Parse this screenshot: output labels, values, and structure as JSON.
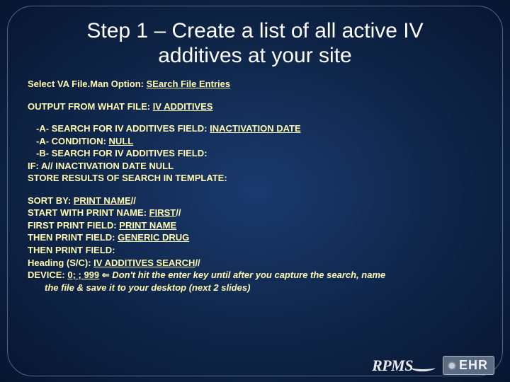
{
  "title_l1": "Step 1 – Create a list of all active IV",
  "title_l2": "additives at your site",
  "line_select_pre": "Select VA File.Man Option: ",
  "line_select_u": "SEarch File Entries",
  "line_output_pre": "OUTPUT FROM WHAT FILE: ",
  "line_output_u": "IV ADDITIVES",
  "line_a1_pre": "-A- SEARCH FOR IV ADDITIVES FIELD: ",
  "line_a1_u": "INACTIVATION DATE",
  "line_a2_pre": "-A- CONDITION: ",
  "line_a2_u": "NULL",
  "line_b": "-B- SEARCH FOR IV ADDITIVES FIELD:",
  "line_if": "IF: A//    INACTIVATION DATE NULL",
  "line_store": "STORE RESULTS OF SEARCH IN TEMPLATE:",
  "line_sort_pre": "SORT BY: ",
  "line_sort_u": "PRINT NAME",
  "line_sort_post": "//",
  "line_start_pre": "START WITH PRINT NAME: ",
  "line_start_u": "FIRST",
  "line_start_post": "//",
  "line_first_pre": "FIRST PRINT FIELD: ",
  "line_first_u": "PRINT NAME",
  "line_then1_pre": "THEN PRINT FIELD: ",
  "line_then1_u": "GENERIC DRUG",
  "line_then2": "THEN PRINT FIELD:",
  "line_heading_pre": "Heading (S/C): ",
  "line_heading_u": "IV ADDITIVES SEARCH",
  "line_heading_post": "//",
  "line_device_pre": "DEVICE: ",
  "line_device_u": "0; ; 999",
  "arrow": "⇐",
  "note1": " Don't hit the enter key until after you capture the search, name",
  "note2": "the file & save it to your desktop (next 2 slides)",
  "rpms": "RPMS",
  "ehr": "EHR"
}
